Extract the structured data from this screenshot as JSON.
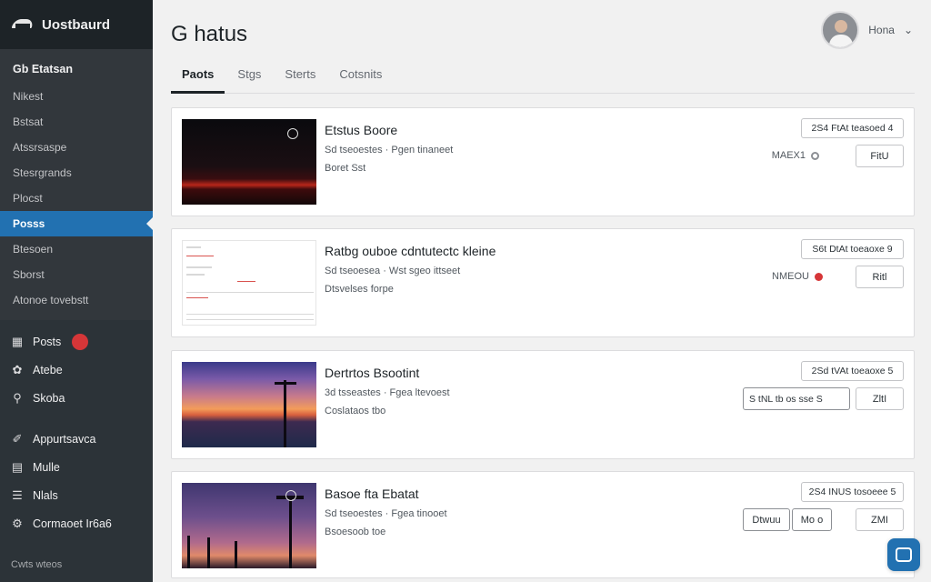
{
  "brand": {
    "title": "Uostbaurd"
  },
  "sidebar": {
    "section_label": "Gb Etatsan",
    "submenu": [
      {
        "label": "Nikest",
        "active": false
      },
      {
        "label": "Bstsat",
        "active": false
      },
      {
        "label": "Atssrsaspe",
        "active": false
      },
      {
        "label": "Stesrgrands",
        "active": false
      },
      {
        "label": "Plocst",
        "active": false
      },
      {
        "label": "Posss",
        "active": true
      },
      {
        "label": "Btesoen",
        "active": false
      },
      {
        "label": "Sborst",
        "active": false
      },
      {
        "label": "Atonoe tovebstt",
        "active": false
      }
    ],
    "menu": [
      {
        "label": "Posts",
        "icon": "posts-icon",
        "badge": "",
        "gap": false
      },
      {
        "label": "Atebe",
        "icon": "media-icon",
        "badge": "",
        "gap": false
      },
      {
        "label": "Skoba",
        "icon": "pin-icon",
        "badge": "",
        "gap": false
      },
      {
        "label": "Appurtsavca",
        "icon": "brush-icon",
        "badge": "",
        "gap": true
      },
      {
        "label": "Mulle",
        "icon": "plugins-icon",
        "badge": "",
        "gap": false
      },
      {
        "label": "Nlals",
        "icon": "tools-icon",
        "badge": "",
        "gap": false
      },
      {
        "label": "Cormaoet Ir6a6",
        "icon": "settings-icon",
        "badge": "",
        "gap": false
      }
    ],
    "collapse_label": "Cwts wteos"
  },
  "header": {
    "title": "G hatus",
    "user_name": "Hona"
  },
  "tabs": [
    {
      "label": "Paots",
      "active": true
    },
    {
      "label": "Stgs",
      "active": false
    },
    {
      "label": "Sterts",
      "active": false
    },
    {
      "label": "Cotsnits",
      "active": false
    }
  ],
  "posts": [
    {
      "title": "Etstus Boore",
      "meta": "Sd tseoestes · Pgen tinaneet",
      "author": "Boret Sst",
      "pill": "2S4 FtAt teasoed 4",
      "status_text": "MAEX1",
      "status_color": "gray",
      "button": "FitU"
    },
    {
      "title": "Ratbg ouboe cdntutectc kleine",
      "meta": "Sd tseoesea · Wst sgeo ittseet",
      "author": "Dtsvelses forpe",
      "pill": "S6t DtAt toeaoxe 9",
      "status_text": "NMEOU",
      "status_color": "red",
      "button": "Ritl"
    },
    {
      "title": "Dertrtos Bsootint",
      "meta": "3d tsseastes · Fgea ltevoest",
      "author": "Coslataos tbo",
      "pill": "2Sd tVAt toeaoxe 5",
      "field": "S  tNL  tb  os  sse  S",
      "button": "ZltI"
    },
    {
      "title": "Basoe fta Ebatat",
      "meta": "Sd tseoestes · Fgea tinooet",
      "author": "Bsoesoob toe",
      "pill": "2S4 INUS tosoeee 5",
      "outline_btn_1": "Dtwuu",
      "outline_btn_2": "Mo  o",
      "button": "ZMI"
    }
  ],
  "colors": {
    "sidebar": "#2c3338",
    "accent": "#2271b1",
    "badge": "#d63638"
  }
}
